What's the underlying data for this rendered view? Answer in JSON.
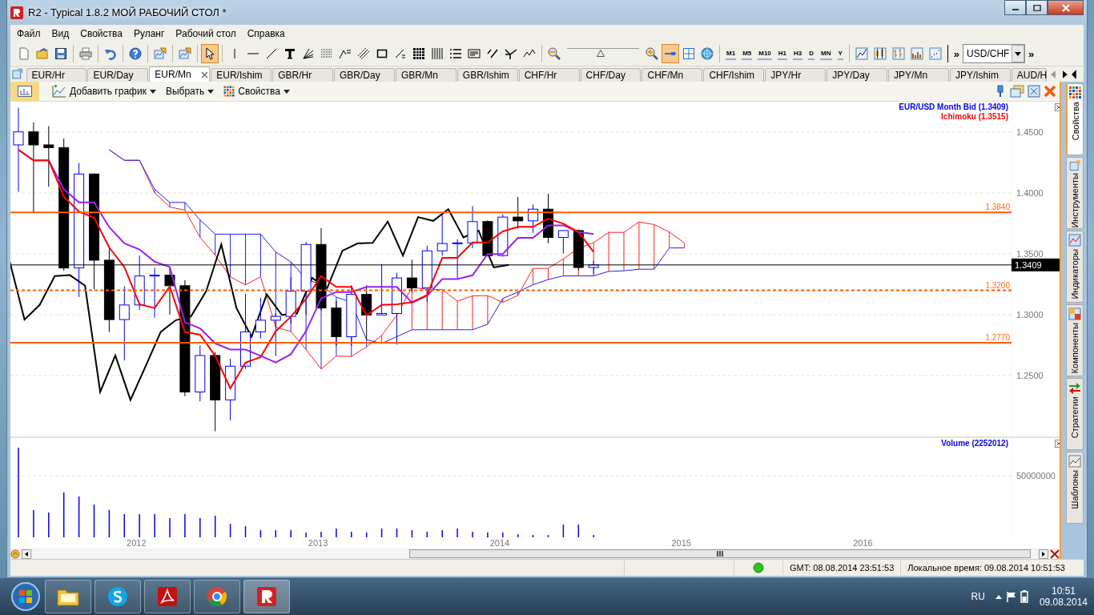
{
  "window": {
    "title": "R2 - Typical 1.8.2 МОЙ РАБОЧИЙ СТОЛ *"
  },
  "menu": [
    "Файл",
    "Вид",
    "Свойства",
    "Руланг",
    "Рабочий стол",
    "Справка"
  ],
  "drawing_tools": [
    {
      "kind": "cursor",
      "selected": true
    },
    {
      "kind": "vline",
      "selected": false
    },
    {
      "kind": "hline",
      "selected": false
    },
    {
      "kind": "trendline",
      "selected": false
    },
    {
      "kind": "text",
      "selected": false
    },
    {
      "kind": "fan",
      "selected": false
    },
    {
      "kind": "levels",
      "selected": false
    },
    {
      "kind": "arcs",
      "selected": false
    },
    {
      "kind": "channel",
      "selected": false
    },
    {
      "kind": "rectangle",
      "selected": false
    },
    {
      "kind": "regression",
      "selected": false
    },
    {
      "kind": "table",
      "selected": false
    },
    {
      "kind": "vbars",
      "selected": false
    },
    {
      "kind": "list",
      "selected": false
    },
    {
      "kind": "note",
      "selected": false
    },
    {
      "kind": "cycles",
      "selected": false
    },
    {
      "kind": "pitchfork",
      "selected": false
    },
    {
      "kind": "wave",
      "selected": false
    }
  ],
  "zoom_slider": {
    "level": 0.47
  },
  "view_tools": [
    {
      "kind": "zoom-in",
      "selected": false
    },
    {
      "kind": "line-mode",
      "selected": true
    },
    {
      "kind": "grid",
      "selected": false
    },
    {
      "kind": "globe",
      "selected": false
    }
  ],
  "timeframes": [
    "M1",
    "M5",
    "M10",
    "H1",
    "H3",
    "D",
    "MN",
    "Y"
  ],
  "overflow": [
    "»",
    "»"
  ],
  "symbol": "USD/CHF",
  "tabs": [
    {
      "label": "EUR/Hr",
      "selected": false
    },
    {
      "label": "EUR/Day",
      "selected": false
    },
    {
      "label": "EUR/Mn",
      "selected": true
    },
    {
      "label": "EUR/Ishim",
      "selected": false
    },
    {
      "label": "GBR/Hr",
      "selected": false
    },
    {
      "label": "GBR/Day",
      "selected": false
    },
    {
      "label": "GBR/Mn",
      "selected": false
    },
    {
      "label": "GBR/Ishim",
      "selected": false
    },
    {
      "label": "CHF/Hr",
      "selected": false
    },
    {
      "label": "CHF/Day",
      "selected": false
    },
    {
      "label": "CHF/Mn",
      "selected": false
    },
    {
      "label": "CHF/Ishim",
      "selected": false
    },
    {
      "label": "JPY/Hr",
      "selected": false
    },
    {
      "label": "JPY/Day",
      "selected": false
    },
    {
      "label": "JPY/Mn",
      "selected": false
    },
    {
      "label": "JPY/Ishim",
      "selected": false
    },
    {
      "label": "AUD/H",
      "selected": false
    }
  ],
  "chart_panel_toggle": {
    "on": true
  },
  "chart_toolbar": [
    "Добавить график",
    "Выбрать",
    "Свойства"
  ],
  "price_pane": {
    "legend": [
      {
        "label": "EUR/USD Month Bid (1.3409)",
        "color": "#0000ff"
      },
      {
        "label": "Ichimoku (1.3515)",
        "color": "#ff0000"
      }
    ],
    "axis_labels": [
      "1.4500",
      "1.4000",
      "1.3500",
      "1.3000",
      "1.2500"
    ],
    "levels": [
      "1.3840",
      "1.3200",
      "1.2770"
    ],
    "last_price": "1.3409"
  },
  "volume_pane": {
    "legend": "Volume (2252012)",
    "axis_label": "50000000"
  },
  "x_axis": [
    "2012",
    "2013",
    "2014",
    "2015",
    "2016"
  ],
  "side_tabs": [
    {
      "label": "Свойства",
      "selected": true
    },
    {
      "label": "Инструменты",
      "selected": false
    },
    {
      "label": "Индикаторы",
      "selected": false
    },
    {
      "label": "Компоненты",
      "selected": false
    },
    {
      "label": "Стратегии",
      "selected": false
    },
    {
      "label": "Шаблоны",
      "selected": false
    }
  ],
  "status_bar": {
    "connected": true,
    "gmt": "GMT:  08.08.2014 23:51:53",
    "local": "Локальное время:  09.08.2014 10:51:53"
  },
  "taskbar": {
    "language": "RU",
    "time": "10:51",
    "date": "09.08.2014"
  }
}
